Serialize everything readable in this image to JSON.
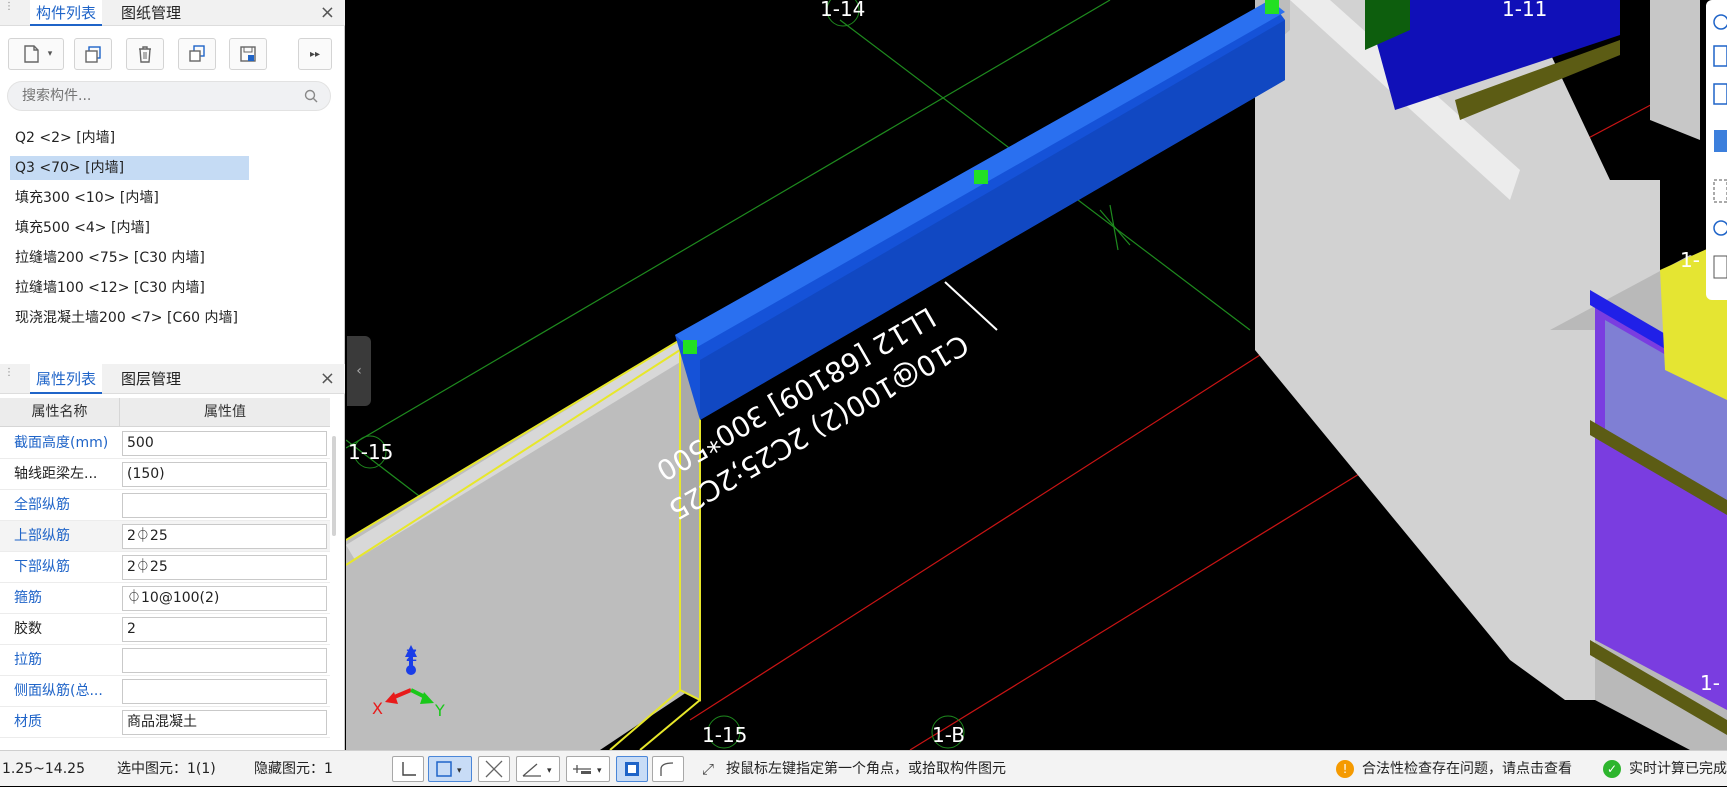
{
  "component_panel": {
    "tab_active": "构件列表",
    "tab_other": "图纸管理",
    "search_placeholder": "搜索构件...",
    "items": [
      "Q2 <2> [内墙]",
      "Q3 <70> [内墙]",
      "填充300 <10> [内墙]",
      "填充500 <4> [内墙]",
      "拉缝墙200 <75> [C30 内墙]",
      "拉缝墙100 <12> [C30 内墙]",
      "现浇混凝土墙200 <7> [C60 内墙]"
    ],
    "selected_index": 1
  },
  "property_panel": {
    "tab_active": "属性列表",
    "tab_other": "图层管理",
    "col_name": "属性名称",
    "col_value": "属性值",
    "rows": [
      {
        "name": "截面高度(mm)",
        "value": "500"
      },
      {
        "name": "轴线距梁左...",
        "value": "(150)"
      },
      {
        "name": "全部纵筋",
        "value": ""
      },
      {
        "name": "上部纵筋",
        "value": "2⏀25"
      },
      {
        "name": "下部纵筋",
        "value": "2⏀25"
      },
      {
        "name": "箍筋",
        "value": "⏀10@100(2)"
      },
      {
        "name": "胶数",
        "value": "2"
      },
      {
        "name": "拉筋",
        "value": ""
      },
      {
        "name": "侧面纵筋(总...",
        "value": ""
      },
      {
        "name": "材质",
        "value": "商品混凝土"
      }
    ]
  },
  "viewport": {
    "axis_labels": [
      "1-14",
      "1-11",
      "1-15",
      "1-15",
      "1-B",
      "1-",
      "1-"
    ],
    "beam_label_line1": "C10@100(2) 2C25;2C25",
    "beam_label_line2": "LL12 [68109] 300*500",
    "triad": {
      "z": "Z",
      "x": "X",
      "y": "Y"
    }
  },
  "status_bar": {
    "elevation": "1.25~14.25",
    "selected": "选中图元：1(1)",
    "hidden": "隐藏图元：1",
    "hint": "按鼠标左键指定第一个角点，或拾取构件图元",
    "warning": "合法性检查存在问题，请点击查看",
    "realtime": "实时计算已完成"
  },
  "colors": {
    "accent": "#1f64c8",
    "beam": "#1657e0",
    "grid_green": "#1e8a1e",
    "grid_red": "#c81414",
    "wall": "#c8c8c8",
    "warning": "#f59a00",
    "ok": "#2db52d"
  }
}
